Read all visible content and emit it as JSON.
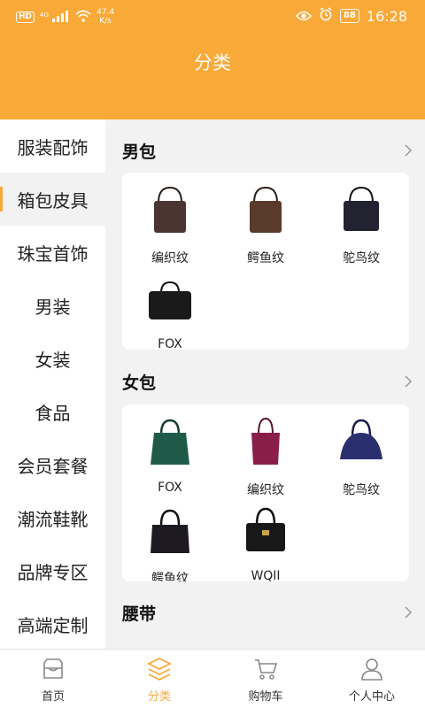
{
  "status_bar": {
    "sim_label": "HD",
    "net_label": "4G",
    "speed_value": "47.4",
    "speed_unit": "K/s",
    "battery": "88",
    "time": "16:28"
  },
  "header": {
    "title": "分类"
  },
  "sidebar": {
    "items": [
      {
        "label": "服装配饰"
      },
      {
        "label": "箱包皮具"
      },
      {
        "label": "珠宝首饰"
      },
      {
        "label": "男装"
      },
      {
        "label": "女装"
      },
      {
        "label": "食品"
      },
      {
        "label": "会员套餐"
      },
      {
        "label": "潮流鞋靴"
      },
      {
        "label": "品牌专区"
      },
      {
        "label": "高端定制"
      }
    ],
    "active_index": 1
  },
  "sections": [
    {
      "title": "男包",
      "products": [
        {
          "label": "编织纹",
          "color": "#4a3530"
        },
        {
          "label": "鳄鱼纹",
          "color": "#5a3a2a"
        },
        {
          "label": "鸵鸟纹",
          "color": "#222230"
        },
        {
          "label": "FOX",
          "color": "#1a1a1a"
        }
      ]
    },
    {
      "title": "女包",
      "products": [
        {
          "label": "FOX",
          "color": "#1f5a48"
        },
        {
          "label": "编织纹",
          "color": "#8a1e4a"
        },
        {
          "label": "鸵鸟纹",
          "color": "#2a2f6e"
        },
        {
          "label": "鳄鱼纹",
          "color": "#1e1a22"
        },
        {
          "label": "WQII",
          "color": "#181818"
        }
      ]
    },
    {
      "title": "腰带",
      "products": []
    }
  ],
  "tab_bar": {
    "tabs": [
      {
        "label": "首页",
        "icon": "home-icon"
      },
      {
        "label": "分类",
        "icon": "layers-icon"
      },
      {
        "label": "购物车",
        "icon": "cart-icon"
      },
      {
        "label": "个人中心",
        "icon": "user-icon"
      }
    ],
    "active_index": 1
  },
  "colors": {
    "accent": "#f9a937",
    "background": "#f2f2f2"
  }
}
